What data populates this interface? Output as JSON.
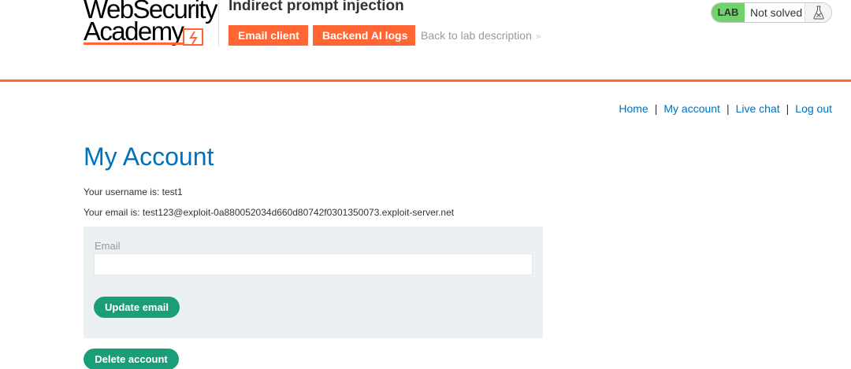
{
  "header": {
    "logo": {
      "line1": "WebSecurity",
      "line2": "Academy"
    },
    "lab_title": "Indirect prompt injection",
    "buttons": {
      "email_client": "Email client",
      "backend_ai_logs": "Backend AI logs"
    },
    "back_link": "Back to lab description",
    "back_chevrons": "»",
    "lab_status": {
      "badge": "LAB",
      "status": "Not solved",
      "icon": "flask-icon"
    }
  },
  "nav": {
    "home": "Home",
    "my_account": "My account",
    "live_chat": "Live chat",
    "log_out": "Log out",
    "separator": "|"
  },
  "main": {
    "title": "My Account",
    "username_line": "Your username is: test1",
    "email_line": "Your email is: test123@exploit-0a880052034d660d80742f0301350073.exploit-server.net",
    "form": {
      "email_label": "Email",
      "email_value": "",
      "email_placeholder": "",
      "update_button": "Update email"
    },
    "delete_button": "Delete account"
  },
  "colors": {
    "accent": "#ff6633",
    "link": "#0071bc",
    "button_green": "#1a9e7a",
    "badge_green": "#70d16d",
    "form_bg": "#ebf0f2"
  }
}
